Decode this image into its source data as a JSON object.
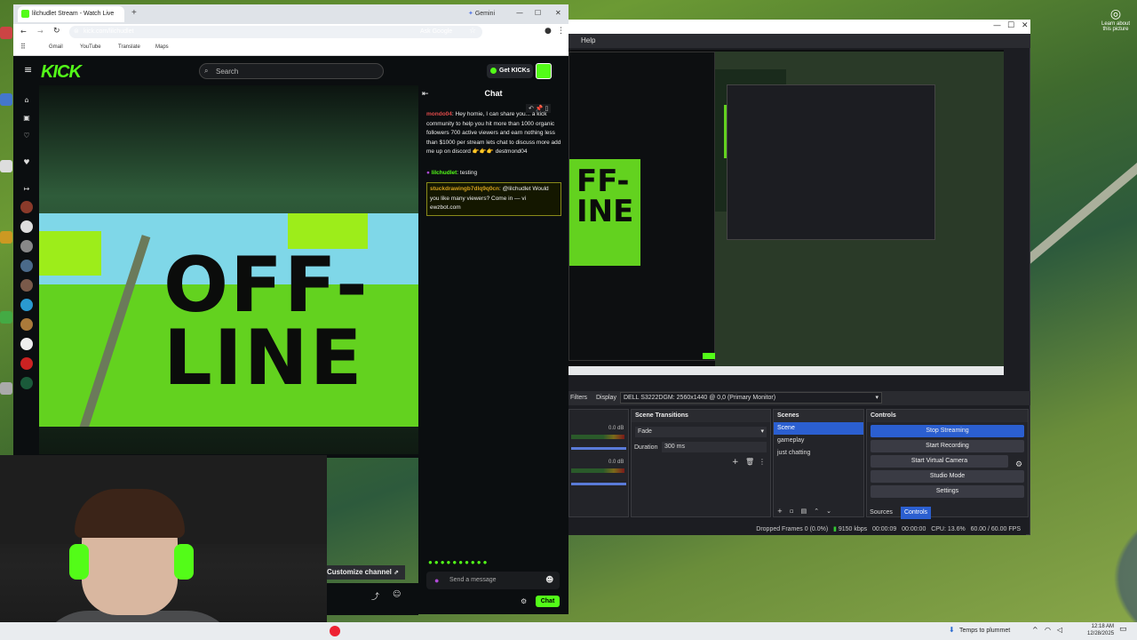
{
  "browser": {
    "tab_title": "lilchudlet Stream - Watch Live",
    "gemini_label": "Gemini",
    "url": "kick.com/lilchudlet",
    "ask_google": "Ask Google",
    "bookmarks": [
      "Gmail",
      "YouTube",
      "Translate",
      "Maps"
    ]
  },
  "kick": {
    "logo": "KICK",
    "search_placeholder": "Search",
    "get_kicks": "Get KICKs",
    "offline_text_1": "OFF-",
    "offline_text_2": "LINE",
    "customize_channel": "Customize channel"
  },
  "chat": {
    "title": "Chat",
    "messages": [
      {
        "user": "mondo04",
        "text": "Hey homie, I can share you... a kick community to help you hit more than 1000 organic followers 700 active viewers and earn nothing less than $1000 per stream lets chat to discuss more add me up on discord 👉👉👉 destmond04"
      },
      {
        "user": "lilchudlet",
        "text": "testing"
      },
      {
        "user": "stuckdrawingb7dlq9q0cn",
        "text": "@lilchudlet Would you like many viewers? Come in — vi ewzbot.com"
      }
    ],
    "send_placeholder": "Send a message",
    "send_button": "Chat"
  },
  "obs": {
    "menu_help": "Help",
    "filters_tab": "Filters",
    "display_label": "Display",
    "display_value": "DELL S3222DGM: 2560x1440 @ 0,0 (Primary Monitor)",
    "transitions": {
      "title": "Scene Transitions",
      "type": "Fade",
      "duration_label": "Duration",
      "duration_value": "300 ms"
    },
    "scenes": {
      "title": "Scenes",
      "items": [
        "Scene",
        "gameplay",
        "just chatting"
      ]
    },
    "controls": {
      "title": "Controls",
      "buttons": [
        "Stop Streaming",
        "Start Recording",
        "Start Virtual Camera",
        "Studio Mode",
        "Settings"
      ],
      "tabs": [
        "Sources",
        "Controls"
      ]
    },
    "audio": {
      "db_1": "0.0 dB",
      "db_2": "0.0 dB"
    },
    "status": {
      "dropped": "Dropped Frames 0 (0.0%)",
      "kbps": "9150 kbps",
      "stream_time": "00:00:09",
      "rec_time": "00:00:00",
      "cpu": "CPU: 13.6%",
      "fps": "60.00 / 60.00 FPS"
    }
  },
  "desktop": {
    "learn_about": "Learn about this picture"
  },
  "taskbar": {
    "weather": "Temps to plummet",
    "time": "12:18 AM",
    "date": "12/28/2025"
  },
  "colors": {
    "kick_green": "#53fc18",
    "obs_blue": "#2b5fd0",
    "chat_bg": "#0b0e10"
  }
}
